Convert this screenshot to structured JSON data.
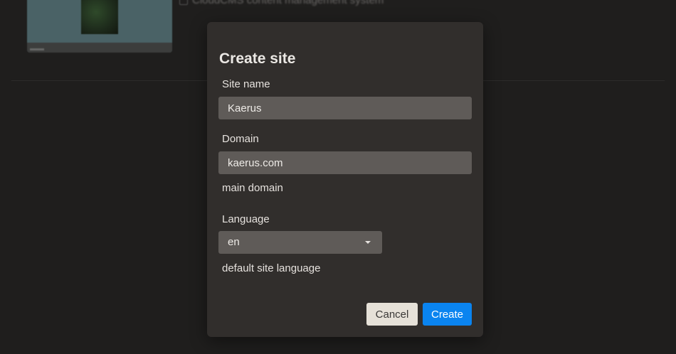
{
  "background": {
    "checkbox_text": "CloudCMS content management system"
  },
  "dialog": {
    "title": "Create site",
    "site_name": {
      "label": "Site name",
      "value": "Kaerus"
    },
    "domain": {
      "label": "Domain",
      "value": "kaerus.com",
      "helper": "main domain"
    },
    "language": {
      "label": "Language",
      "value": "en",
      "helper": "default site language"
    },
    "buttons": {
      "cancel": "Cancel",
      "create": "Create"
    }
  },
  "colors": {
    "primary_button": "#0a84f0",
    "secondary_button": "#e6e1d8",
    "dialog_background": "#312e2c",
    "input_background": "#5f5b58"
  }
}
